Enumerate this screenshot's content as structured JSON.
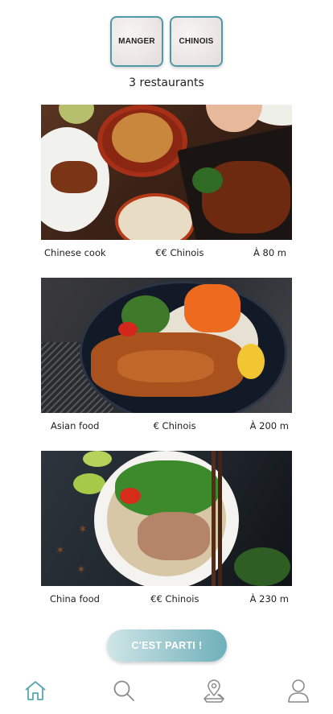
{
  "filters": [
    {
      "label": "MANGER"
    },
    {
      "label": "CHINOIS"
    }
  ],
  "results": {
    "count_text": "3 restaurants"
  },
  "restaurants": [
    {
      "name": "Chinese cook",
      "price_category": "€€ Chinois",
      "distance": "À 80 m"
    },
    {
      "name": "Asian food",
      "price_category": "€ Chinois",
      "distance": "À 200 m"
    },
    {
      "name": "China food",
      "price_category": "€€ Chinois",
      "distance": "À 230 m"
    }
  ],
  "cta": {
    "label": "C'EST PARTI !"
  },
  "bottom_nav": [
    {
      "icon": "home-icon",
      "active": true
    },
    {
      "icon": "search-icon",
      "active": false
    },
    {
      "icon": "map-pin-icon",
      "active": false
    },
    {
      "icon": "user-icon",
      "active": false
    }
  ],
  "colors": {
    "accent": "#4f98a5",
    "nav_active": "#5aa6b3",
    "nav_inactive": "#8a8a8a",
    "cta_gradient_start": "#cfe6e8",
    "cta_gradient_end": "#6fb0ba"
  }
}
